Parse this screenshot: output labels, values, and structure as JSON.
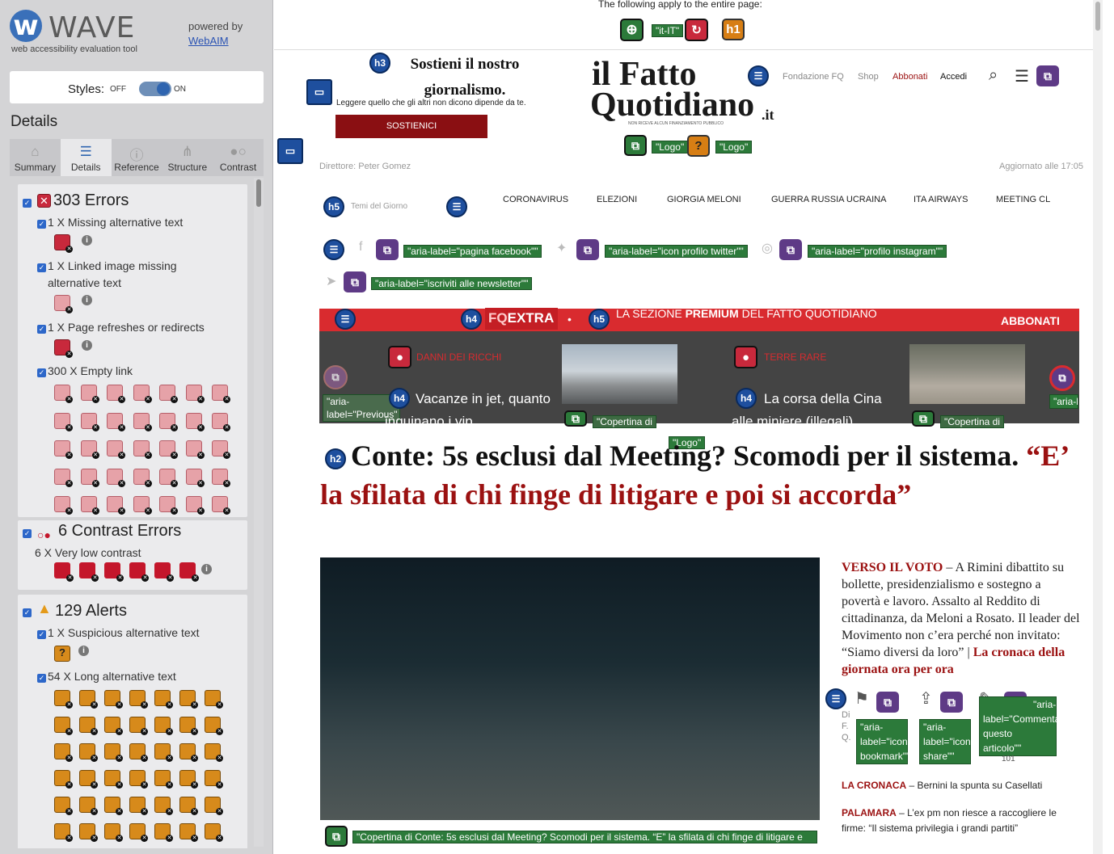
{
  "wave": {
    "title": "WAVE",
    "subtitle": "web accessibility evaluation tool",
    "powered_by": "powered by",
    "webaim": "WebAIM",
    "styles_label": "Styles:",
    "styles_off": "OFF",
    "styles_on": "ON",
    "details_heading": "Details",
    "tabs": [
      {
        "label": "Summary",
        "icon": "home-icon"
      },
      {
        "label": "Details",
        "icon": "list-icon"
      },
      {
        "label": "Reference",
        "icon": "info-icon"
      },
      {
        "label": "Structure",
        "icon": "structure-icon"
      },
      {
        "label": "Contrast",
        "icon": "contrast-icon"
      }
    ],
    "errors": {
      "heading": "303 Errors",
      "items": [
        "1 X Missing alternative text",
        "1 X Linked image missing alternative text",
        "1 X Page refreshes or redirects",
        "300 X Empty link"
      ]
    },
    "contrast": {
      "heading": "6 Contrast Errors",
      "item": "6 X Very low contrast"
    },
    "alerts": {
      "heading": "129 Alerts",
      "items": [
        "1 X Suspicious alternative text",
        "54 X Long alternative text"
      ]
    }
  },
  "page": {
    "top_note": "The following apply to the entire page:",
    "lang_tag": "\"it-IT\"",
    "support_heading": "Sostieni il nostro giornalismo.",
    "support_text": "Leggere quello che gli altri non dicono dipende da te.",
    "support_button": "SOSTIENICI",
    "logo_line1": "il Fatto",
    "logo_line2": "Quotidiano",
    "logo_suffix": ".it",
    "logo_tagline": "NON RICEVE ALCUN FINANZIAMENTO PUBBLICO",
    "logo_tag_1": "\"Logo\"",
    "logo_tag_2": "\"Logo\"",
    "nav": {
      "fondazione": "Fondazione FQ",
      "shop": "Shop",
      "abbonati": "Abbonati",
      "accedi": "Accedi"
    },
    "director": "Direttore: Peter Gomez",
    "updated": "Aggiornato alle 17:05",
    "temi": "Temi del Giorno",
    "menu": [
      "CORONAVIRUS",
      "ELEZIONI",
      "GIORGIA MELONI",
      "GUERRA RUSSIA UCRAINA",
      "ITA AIRWAYS",
      "MEETING CL"
    ],
    "social_labels": [
      "\"aria-label=\"pagina facebook\"\"",
      "\"aria-label=\"icon profilo twitter\"\"",
      "\"aria-label=\"profilo instagram\"\"",
      "\"aria-label=\"iscriviti alle newsletter\"\""
    ],
    "banner": {
      "fq": "FQ",
      "extra": "EXTRA",
      "text_a": "LA SEZIONE ",
      "text_b": "PREMIUM",
      "text_c": " DEL FATTO QUOTIDIANO",
      "abbonati": "ABBONATI"
    },
    "strip": {
      "prev_label": "\"aria-label=\"Previous\"",
      "item1_kicker": "DANNI DEI RICCHI",
      "item1_title": "Vacanze in jet, quanto inquinano i vip",
      "item1_cover": "\"Copertina di",
      "item2_kicker": "TERRE RARE",
      "item2_title": "La corsa della Cina alle miniere (illegali)",
      "item2_cover": "\"Copertina di",
      "next_label": "\"aria-label="
    },
    "article": {
      "logo_tag": "\"Logo\"",
      "title_black": "Conte: 5s esclusi dal Meeting? Scomodi per il sistema. ",
      "title_red": "“E’ la sfilata di chi finge di litigare e poi si accorda”",
      "cover_label": "\"Copertina di Conte: 5s esclusi dal Meeting? Scomodi per il sistema. “E” la sfilata di chi finge di litigare e",
      "kicker": "VERSO IL VOTO",
      "summary": " – A Rimini dibattito su bollette, presidenzialismo e sostegno a povertà e lavoro. Assalto al Reddito di cittadinanza, da Meloni a Rosato. Il leader del Movimento non c’era perché non invitato: “Siamo diversi da loro” | ",
      "summary_link": "La cronaca della giornata ora per ora",
      "author": "Di F. Q.",
      "bookmark_label": "\"aria-label=\"icon bookmark\"\"",
      "share_label": "\"aria-label=\"icon share\"\"",
      "comment_label": "\"aria-label=\"Commenta questo articolo\"\"",
      "comment_count": "101",
      "related": [
        {
          "kicker": "LA CRONACA",
          "text": " – Bernini la spunta su Casellati"
        },
        {
          "kicker": "PALAMARA",
          "text": " – L’ex pm non riesce a raccogliere le firme: “Il sistema privilegia i grandi partiti”"
        }
      ]
    }
  },
  "colors": {
    "wave_blue": "#2f65b0",
    "error_red": "#c8293c",
    "alert_orange": "#d77e14",
    "aria_green": "#2c7a3a",
    "fq_red": "#d92b2f",
    "headline_red": "#9b1111"
  }
}
